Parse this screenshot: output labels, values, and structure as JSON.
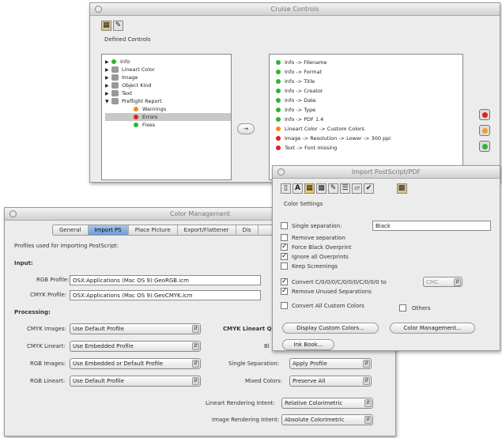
{
  "cruise": {
    "title": "Cruise Controls",
    "defined_label": "Defined Controls",
    "tree": [
      {
        "label": "Info",
        "icon": "info-icon",
        "level": 0
      },
      {
        "label": "Lineart Color",
        "icon": "color-icon",
        "level": 0
      },
      {
        "label": "Image",
        "icon": "image-icon",
        "level": 0
      },
      {
        "label": "Object Kind",
        "icon": "object-icon",
        "level": 0
      },
      {
        "label": "Text",
        "icon": "text-icon",
        "level": 0
      },
      {
        "label": "Preflight Report",
        "icon": "report-icon",
        "level": 0
      },
      {
        "label": "Warnings",
        "icon": "orange-dot-icon",
        "level": 1
      },
      {
        "label": "Errors",
        "icon": "red-dot-icon",
        "level": 1
      },
      {
        "label": "Fixes",
        "icon": "green-dot-icon",
        "level": 1
      }
    ],
    "arrow_label": "→",
    "rules": [
      {
        "text": "Info -> Filename",
        "color": "#2db52d"
      },
      {
        "text": "Info -> Format",
        "color": "#2db52d"
      },
      {
        "text": "Info -> Title",
        "color": "#2db52d"
      },
      {
        "text": "Info -> Creator",
        "color": "#2db52d"
      },
      {
        "text": "Info -> Date",
        "color": "#2db52d"
      },
      {
        "text": "Info -> Type",
        "color": "#2db52d"
      },
      {
        "text": "Info -> PDF 1.4",
        "color": "#2db52d"
      },
      {
        "text": "Lineart Color -> Custom Colors",
        "color": "#f08a1c"
      },
      {
        "text": "Image -> Resolution -> Lower -> 300 ppi",
        "color": "#e01f1f"
      },
      {
        "text": "Text -> Font missing",
        "color": "#e01f1f"
      }
    ],
    "lights": [
      "#e01f1f",
      "#f0a020",
      "#2db52d"
    ]
  },
  "colormgmt": {
    "title": "Color Management",
    "tabs": [
      "General",
      "Import PS",
      "Place Picture",
      "Export/Flattener",
      "Dis"
    ],
    "selected_tab": 1,
    "heading": "Profiles used for importing PostScript:",
    "input_section": "Input:",
    "rgb_profile_label": "RGB Profile:",
    "rgb_profile_value": "OSX:Applications (Mac OS 9):GeoRGB.icm",
    "cmyk_profile_label": "CMYK Profile:",
    "cmyk_profile_value": "OSX:Applications (Mac OS 9):GeoCMYK.icm",
    "processing_section": "Processing:",
    "cmyk_images_label": "CMYK Images:",
    "cmyk_images_value": "Use Default Profile",
    "cmyk_lineart_label": "CMYK Lineart:",
    "cmyk_lineart_value": "Use Embedded Profile",
    "rgb_images_label": "RGB Images:",
    "rgb_images_value": "Use Embedded or Default Profile",
    "rgb_lineart_label": "RGB Lineart:",
    "rgb_lineart_value": "Use Default Profile",
    "cmyk_lineart_qa_label": "CMYK Lineart Qu",
    "bl_label": "Bl",
    "single_sep_label": "Single Separation:",
    "single_sep_value": "Apply Profile",
    "mixed_colors_label": "Mixed Colors:",
    "mixed_colors_value": "Preserve All",
    "lineart_intent_label": "Lineart Rendering Intent:",
    "lineart_intent_value": "Relative Colorimetric",
    "image_intent_label": "Image Rendering Intent:",
    "image_intent_value": "Absolute Colorimetric"
  },
  "importps": {
    "title": "Import PostScript/PDF",
    "toolbar_icons": [
      "page-icon",
      "text-icon",
      "image-icon",
      "color-settings-icon",
      "brush-icon",
      "barcode-icon",
      "bookmark-icon",
      "tools-icon",
      "gear-icon"
    ],
    "section": "Color Settings",
    "single_sep_label": "Single separation:",
    "single_sep_value": "Black",
    "options": [
      {
        "label": "Remove separation",
        "checked": false
      },
      {
        "label": "Force Black Overprint",
        "checked": true
      },
      {
        "label": "Ignore all Overprints",
        "checked": true
      },
      {
        "label": "Keep Screenings",
        "checked": false
      },
      {
        "label": "Convert C/0/0/0/C/0/0/0/C/0/0/0 to",
        "checked": true
      },
      {
        "label": "Remove Unused Separations",
        "checked": true
      },
      {
        "label": "Convert All Custom Colors",
        "checked": false
      }
    ],
    "convert_target": "CMC",
    "others_label": "Others",
    "display_custom_btn": "Display Custom Colors...",
    "color_mgmt_btn": "Color Management...",
    "ink_book_btn": "Ink Book..."
  }
}
